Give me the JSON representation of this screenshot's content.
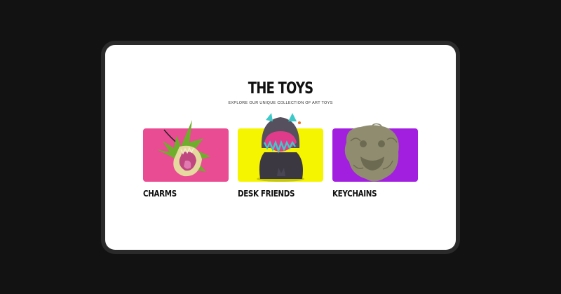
{
  "section": {
    "title": "THE TOYS",
    "subtitle": "EXPLORE OUR UNIQUE COLLECTION OF ART TOYS"
  },
  "categories": [
    {
      "label": "CHARMS",
      "background": "#ea4c93",
      "icon": "plant-monster-charm"
    },
    {
      "label": "DESK FRIENDS",
      "background": "#f5f500",
      "icon": "purple-monster-figure"
    },
    {
      "label": "KEYCHAINS",
      "background": "#a21fe0",
      "icon": "stone-lion-keychain"
    }
  ],
  "colors": {
    "page_bg": "#121212",
    "screen_bg": "#ffffff",
    "text": "#111111"
  }
}
